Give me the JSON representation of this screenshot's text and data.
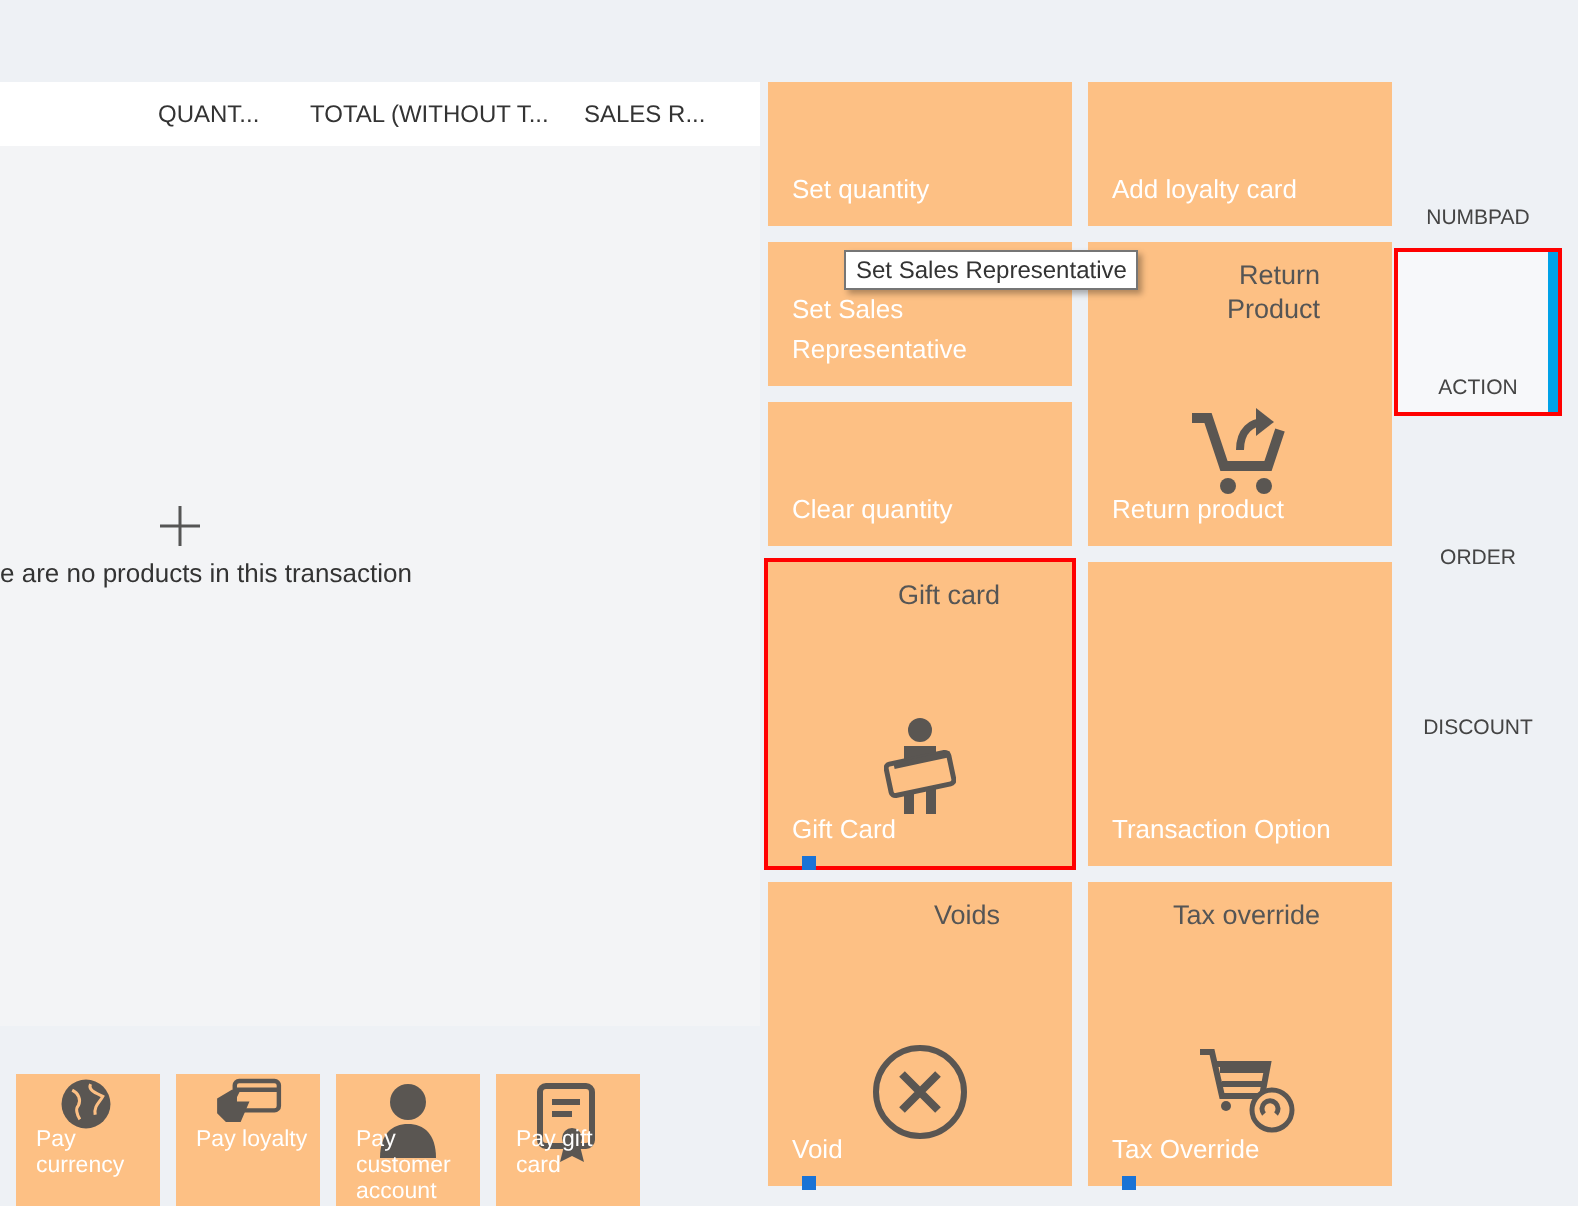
{
  "table": {
    "columns": [
      "QUANT...",
      "TOTAL (WITHOUT T...",
      "SALES R..."
    ],
    "empty_message": "e are no products in this transaction"
  },
  "payment_buttons": [
    {
      "label": "Pay currency"
    },
    {
      "label": "Pay loyalty"
    },
    {
      "label": "Pay customer account"
    },
    {
      "label": "Pay gift card"
    }
  ],
  "action_columns": [
    [
      {
        "label": "Set quantity",
        "highlighted": false,
        "marker": false
      },
      {
        "label": "Set Sales Representative",
        "highlighted": false,
        "marker": false
      },
      {
        "label": "Clear quantity",
        "highlighted": false,
        "marker": false
      },
      {
        "label": "Gift Card",
        "title": "Gift card",
        "highlighted": true,
        "marker": true
      },
      {
        "label": "Void",
        "title": "Voids",
        "highlighted": false,
        "marker": true
      }
    ],
    [
      {
        "label": "Add loyalty card",
        "highlighted": false,
        "marker": false
      },
      {
        "label": "Return product",
        "title": "Return Product",
        "highlighted": false,
        "marker": false
      },
      {
        "label": "Transaction Option",
        "highlighted": false,
        "marker": false
      },
      {
        "label": "Tax Override",
        "title": "Tax override",
        "highlighted": false,
        "marker": true
      }
    ]
  ],
  "tooltip": "Set Sales Representative",
  "nav_tabs": [
    {
      "label": "NUMBPAD",
      "selected": false,
      "highlighted": false
    },
    {
      "label": "ACTION",
      "selected": true,
      "highlighted": true
    },
    {
      "label": "ORDER",
      "selected": false,
      "highlighted": false
    },
    {
      "label": "DISCOUNT",
      "selected": false,
      "highlighted": false
    }
  ]
}
